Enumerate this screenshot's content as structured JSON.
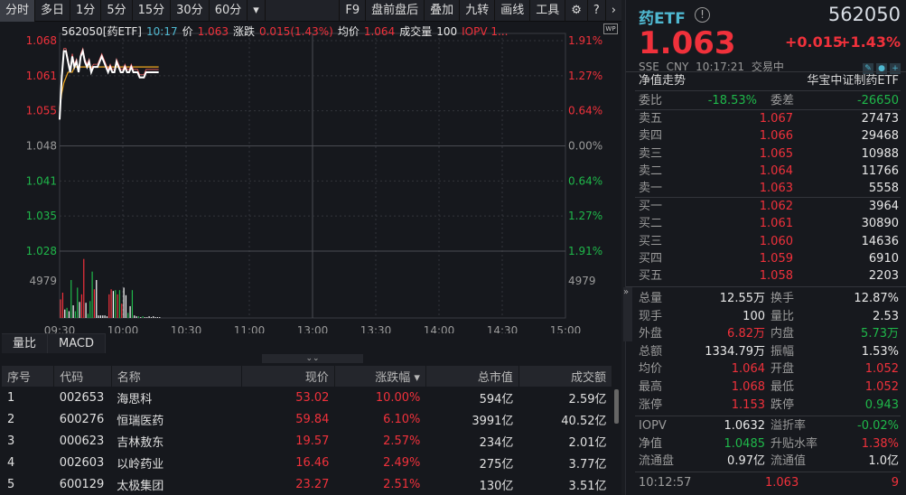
{
  "toolbar": {
    "left": [
      "分时",
      "多日",
      "1分",
      "5分",
      "15分",
      "30分",
      "60分",
      "▾"
    ],
    "right": [
      "F9",
      "盘前盘后",
      "叠加",
      "九转",
      "画线",
      "工具"
    ],
    "settings_icon": "gear-icon",
    "help_icon": "help-icon",
    "more_icon": "chevron-right-icon"
  },
  "chart_info": {
    "code": "562050[药ETF]",
    "time": "10:17",
    "price_label": "价",
    "price": "1.063",
    "change_label": "涨跌",
    "change": "0.015(1.43%)",
    "avg_label": "均价",
    "avg": "1.064",
    "vol_label": "成交量",
    "vol": "100",
    "iopv": "IOPV  1...",
    "wp": "WP"
  },
  "chart_data": {
    "type": "line",
    "title": "562050 分时",
    "x_ticks": [
      "09:30",
      "10:00",
      "10:30",
      "11:00",
      "13:00",
      "13:30",
      "14:00",
      "14:30",
      "15:00"
    ],
    "y_left_ticks": [
      "1.068",
      "1.061",
      "1.055",
      "1.048",
      "1.041",
      "1.035",
      "1.028"
    ],
    "y_right_ticks": [
      "1.91%",
      "1.27%",
      "0.64%",
      "0.00%",
      "0.64%",
      "1.27%",
      "1.91%"
    ],
    "ylim": [
      1.028,
      1.068
    ],
    "pre_close": 1.048,
    "vol_tick": "4979",
    "price": [
      1.053,
      1.061,
      1.066,
      1.066,
      1.064,
      1.062,
      1.065,
      1.063,
      1.064,
      1.062,
      1.065,
      1.066,
      1.064,
      1.063,
      1.064,
      1.062,
      1.063,
      1.063,
      1.063,
      1.064,
      1.065,
      1.064,
      1.063,
      1.062,
      1.063,
      1.062,
      1.062,
      1.064,
      1.063,
      1.062,
      1.062,
      1.063,
      1.062,
      1.062,
      1.063,
      1.062,
      1.062,
      1.062,
      1.061,
      1.061,
      1.061,
      1.062,
      1.062,
      1.062,
      1.062,
      1.062,
      1.062,
      1.062
    ],
    "avg": [
      1.055,
      1.058,
      1.06,
      1.061,
      1.062,
      1.062,
      1.062,
      1.063,
      1.063,
      1.063,
      1.063,
      1.063,
      1.063,
      1.063,
      1.063,
      1.063,
      1.063,
      1.063,
      1.063,
      1.063,
      1.063,
      1.063,
      1.063,
      1.063,
      1.063,
      1.063,
      1.063,
      1.063,
      1.063,
      1.063,
      1.063,
      1.063,
      1.063,
      1.063,
      1.063,
      1.063,
      1.063,
      1.063,
      1.063,
      1.063,
      1.063,
      1.063,
      1.063,
      1.063,
      1.063,
      1.063,
      1.063,
      1.063
    ],
    "volume": [
      2200,
      3000,
      1000,
      1200,
      800,
      4500,
      1500,
      800,
      3600,
      1900,
      2800,
      7000,
      1800,
      500,
      2000,
      5500,
      3400,
      4500,
      300,
      300,
      300,
      300,
      200,
      2800,
      3400,
      3200,
      3300,
      2800,
      3300,
      1700,
      3600,
      2700,
      600,
      1400,
      3300,
      300,
      200,
      200,
      100,
      200,
      100,
      100,
      200,
      100,
      200,
      100,
      100,
      100
    ],
    "volume_dir": [
      "r",
      "r",
      "w",
      "g",
      "w",
      "g",
      "w",
      "g",
      "g",
      "w",
      "r",
      "r",
      "w",
      "g",
      "g",
      "g",
      "r",
      "w",
      "w",
      "w",
      "w",
      "w",
      "w",
      "r",
      "r",
      "w",
      "g",
      "r",
      "g",
      "r",
      "w",
      "w",
      "g",
      "w",
      "g",
      "w",
      "w",
      "g",
      "w",
      "g",
      "w",
      "w",
      "w",
      "w",
      "w",
      "w",
      "w",
      "w"
    ]
  },
  "sub_tabs": [
    "量比",
    "MACD"
  ],
  "table": {
    "headers": [
      "序号",
      "代码",
      "名称",
      "现价",
      "涨跌幅 ▾",
      "总市值",
      "成交额"
    ],
    "rows": [
      [
        "1",
        "002653",
        "海思科",
        "53.02",
        "10.00%",
        "594亿",
        "2.59亿"
      ],
      [
        "2",
        "600276",
        "恒瑞医药",
        "59.84",
        "6.10%",
        "3991亿",
        "40.52亿"
      ],
      [
        "3",
        "000623",
        "吉林敖东",
        "19.57",
        "2.57%",
        "234亿",
        "2.01亿"
      ],
      [
        "4",
        "002603",
        "以岭药业",
        "16.46",
        "2.49%",
        "275亿",
        "3.77亿"
      ],
      [
        "5",
        "600129",
        "太极集团",
        "23.27",
        "2.51%",
        "130亿",
        "3.51亿"
      ]
    ]
  },
  "quote": {
    "name": "药ETF",
    "code": "562050",
    "price": "1.063",
    "change": "+0.015",
    "change_pct": "+1.43%",
    "exchange": "SSE",
    "currency": "CNY",
    "time": "10:17:21",
    "status": "交易中",
    "nav_trend": "净值走势",
    "full_name": "华宝中证制药ETF",
    "wb_label": "委比",
    "wb": "-18.53%",
    "wc_label": "委差",
    "wc": "-26650",
    "asks": [
      [
        "卖五",
        "1.067",
        "27473"
      ],
      [
        "卖四",
        "1.066",
        "29468"
      ],
      [
        "卖三",
        "1.065",
        "10988"
      ],
      [
        "卖二",
        "1.064",
        "11766"
      ],
      [
        "卖一",
        "1.063",
        "5558"
      ]
    ],
    "bids": [
      [
        "买一",
        "1.062",
        "3964"
      ],
      [
        "买二",
        "1.061",
        "30890"
      ],
      [
        "买三",
        "1.060",
        "14636"
      ],
      [
        "买四",
        "1.059",
        "6910"
      ],
      [
        "买五",
        "1.058",
        "2203"
      ]
    ],
    "stats": [
      [
        "总量",
        "12.55万",
        "white",
        "换手",
        "12.87%",
        "white"
      ],
      [
        "现手",
        "100",
        "white",
        "量比",
        "2.53",
        "white"
      ],
      [
        "外盘",
        "6.82万",
        "red",
        "内盘",
        "5.73万",
        "green"
      ],
      [
        "总额",
        "1334.79万",
        "white",
        "振幅",
        "1.53%",
        "white"
      ],
      [
        "均价",
        "1.064",
        "red",
        "开盘",
        "1.052",
        "red"
      ],
      [
        "最高",
        "1.068",
        "red",
        "最低",
        "1.052",
        "red"
      ],
      [
        "涨停",
        "1.153",
        "red",
        "跌停",
        "0.943",
        "green"
      ]
    ],
    "etf": [
      [
        "IOPV",
        "1.0632",
        "white",
        "溢折率",
        "-0.02%",
        "green"
      ],
      [
        "净值",
        "1.0485",
        "green",
        "升贴水率",
        "1.38%",
        "red"
      ],
      [
        "流通盘",
        "0.97亿",
        "white",
        "流通值",
        "1.0亿",
        "white"
      ]
    ],
    "tick": {
      "time": "10:12:57",
      "price": "1.063",
      "vol": "9"
    }
  }
}
